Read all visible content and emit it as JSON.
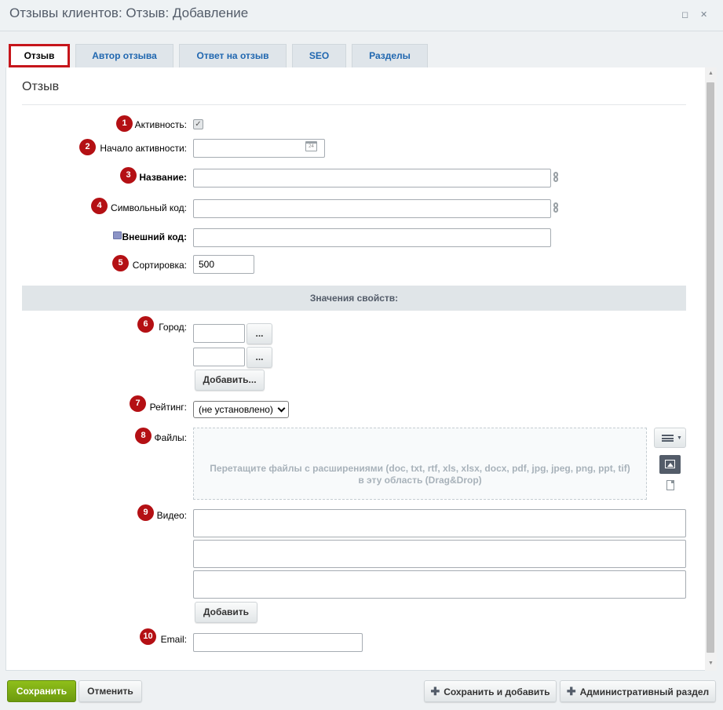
{
  "window": {
    "title": "Отзывы клиентов: Отзыв: Добавление"
  },
  "tabs": [
    {
      "label": "Отзыв",
      "active": true
    },
    {
      "label": "Автор отзыва",
      "active": false
    },
    {
      "label": "Ответ на отзыв",
      "active": false
    },
    {
      "label": "SEO",
      "active": false
    },
    {
      "label": "Разделы",
      "active": false
    }
  ],
  "section": {
    "title": "Отзыв"
  },
  "form": {
    "active_label": "Активность:",
    "active_checked": true,
    "start_label": "Начало активности:",
    "start_value": "",
    "name_label": "Название:",
    "name_value": "",
    "code_label": "Символьный код:",
    "code_value": "",
    "ext_label": "Внешний код:",
    "ext_value": "",
    "sort_label": "Сортировка:",
    "sort_value": "500"
  },
  "properties": {
    "header": "Значения свойств:",
    "city_label": "Город:",
    "browse_label": "...",
    "add_more_label": "Добавить...",
    "rating_label": "Рейтинг:",
    "rating_value": "(не установлено)",
    "files_label": "Файлы:",
    "dropzone_line1": "Перетащите файлы с расширениями (doc, txt, rtf, xls, xlsx, docx, pdf, jpg, jpeg, png, ppt, tif)",
    "dropzone_line2": "в эту область (Drag&Drop)",
    "video_label": "Видео:",
    "add_label": "Добавить",
    "email_label": "Email:",
    "email_value": ""
  },
  "badges": [
    "1",
    "2",
    "3",
    "4",
    "5",
    "6",
    "7",
    "8",
    "9",
    "10"
  ],
  "footer": {
    "save": "Сохранить",
    "cancel": "Отменить",
    "save_add": "Сохранить и добавить",
    "admin": "Административный раздел"
  },
  "icons": {
    "minimize": "minimize-icon",
    "close": "close-icon",
    "calendar": "calendar-icon",
    "chain": "translit-chain-icon",
    "menu": "menu-icon",
    "image": "image-icon",
    "file": "file-icon"
  },
  "colors": {
    "accent_red": "#c6151b",
    "badge_red": "#b41014",
    "save_green": "#7ca514",
    "tab_link": "#2067b0"
  }
}
